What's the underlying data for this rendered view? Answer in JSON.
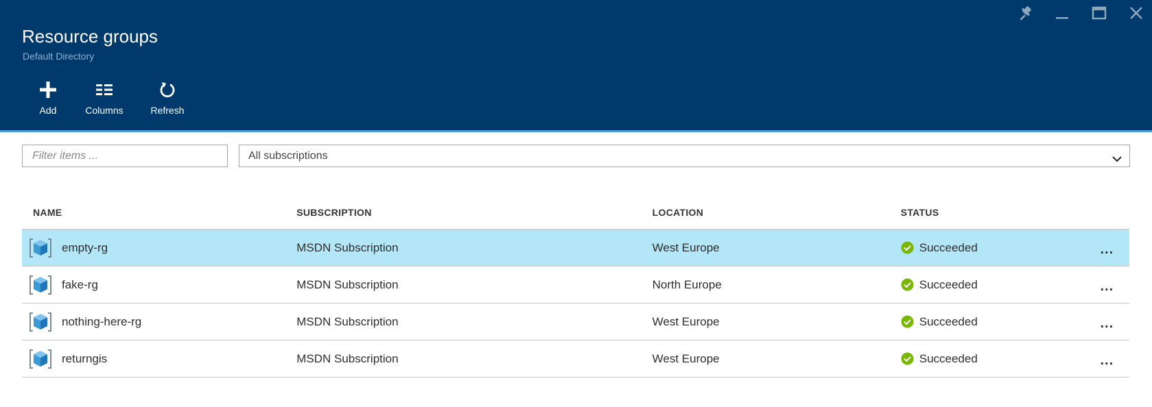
{
  "header": {
    "title": "Resource groups",
    "subtitle": "Default Directory",
    "window_controls": [
      {
        "name": "pin",
        "icon": "pin-icon"
      },
      {
        "name": "minimize",
        "icon": "minimize-icon"
      },
      {
        "name": "maximize",
        "icon": "maximize-icon"
      },
      {
        "name": "close",
        "icon": "close-icon"
      }
    ]
  },
  "toolbar": {
    "add_label": "Add",
    "columns_label": "Columns",
    "refresh_label": "Refresh"
  },
  "filters": {
    "search_placeholder": "Filter items ...",
    "search_value": "",
    "subscription_selected": "All subscriptions"
  },
  "table": {
    "headers": {
      "name": "NAME",
      "subscription": "SUBSCRIPTION",
      "location": "LOCATION",
      "status": "STATUS"
    },
    "rows": [
      {
        "name": "empty-rg",
        "subscription": "MSDN Subscription",
        "location": "West Europe",
        "status": "Succeeded",
        "more": "...",
        "selected": true
      },
      {
        "name": "fake-rg",
        "subscription": "MSDN Subscription",
        "location": "North Europe",
        "status": "Succeeded",
        "more": "...",
        "selected": false
      },
      {
        "name": "nothing-here-rg",
        "subscription": "MSDN Subscription",
        "location": "West Europe",
        "status": "Succeeded",
        "more": "...",
        "selected": false
      },
      {
        "name": "returngis",
        "subscription": "MSDN Subscription",
        "location": "West Europe",
        "status": "Succeeded",
        "more": "...",
        "selected": false
      }
    ]
  },
  "colors": {
    "header_bg": "#003a6c",
    "accent_line": "#4aa0e0",
    "selected_row": "#b3e7f7",
    "status_success": "#7ab800",
    "cube_icon": "#3c9bd6"
  }
}
